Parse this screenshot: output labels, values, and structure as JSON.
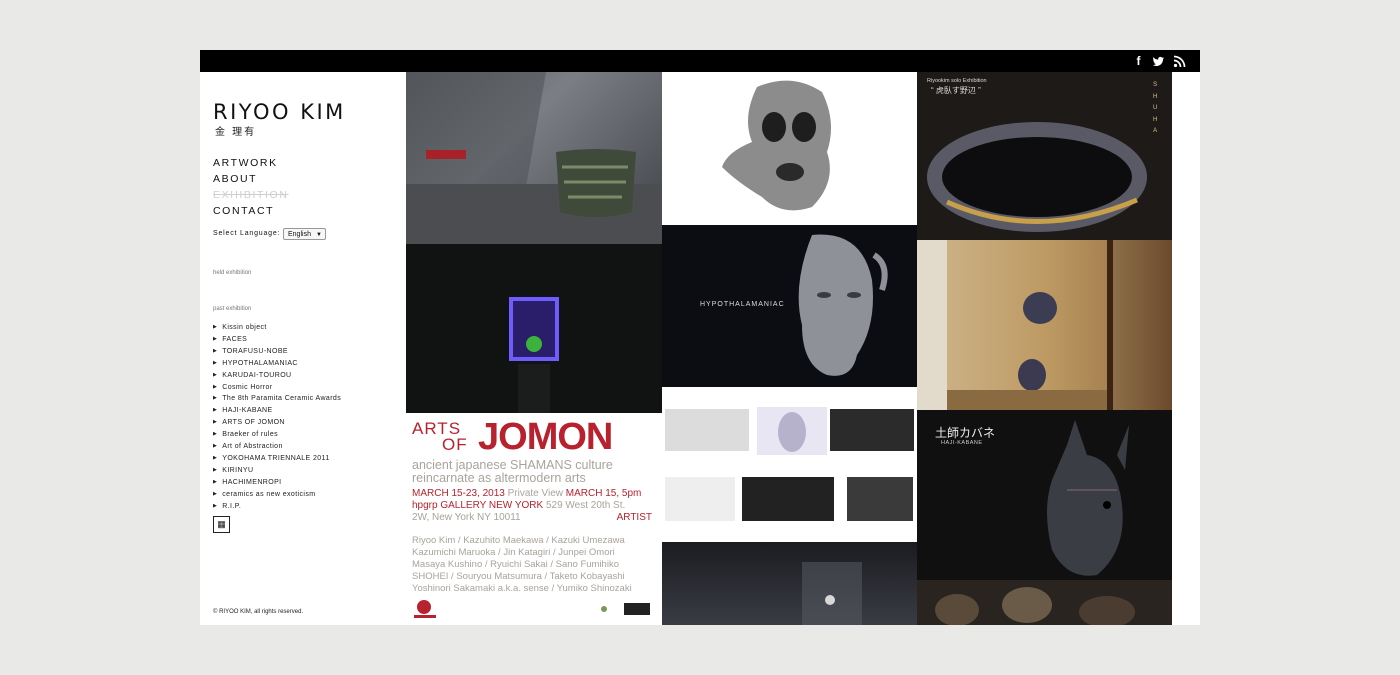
{
  "site": {
    "title": "RIYOO KIM",
    "subtitle": "金 理有",
    "nav": [
      "ARTWORK",
      "ABOUT",
      "EXHIBITION",
      "CONTACT"
    ],
    "language_label": "Select Language:",
    "language_value": "English",
    "held_label": "held exhibition",
    "past_label": "past exhibition",
    "past_items": [
      "Kissin object",
      "FACES",
      "TORAFUSU-NOBE",
      "HYPOTHALAMANIAC",
      "KARUDAI-TOUROU",
      "Cosmic Horror",
      "The 8th Paramita Ceramic Awards",
      "HAJI-KABANE",
      "ARTS OF JOMON",
      "Braeker of rules",
      "Art of Abstraction",
      "YOKOHAMA TRIENNALE 2011",
      "KIRINYU",
      "HACHIMENROPI",
      "ceramics as new exoticism",
      "R.I.P."
    ],
    "copyright": "© RIYOO KIM, all rights reserved."
  },
  "social": {
    "facebook": "f",
    "twitter": "t",
    "rss": "rss"
  },
  "icons": [
    "facebook-icon",
    "twitter-icon",
    "rss-icon",
    "chevron-down-icon",
    "triangle-right-icon",
    "stamp-icon"
  ],
  "tiles": {
    "hypothalamaniac_caption": "HYPOTHALAMANIAC",
    "shuha": {
      "header": "Riyookim solo Exhibition",
      "title": "“ 虎臥す野辺 ”",
      "vertical": [
        "S",
        "H",
        "U",
        "H",
        "A"
      ]
    },
    "haji": {
      "title": "土師カバネ",
      "sub": "HAJI-KABANE"
    },
    "poster": {
      "title_left_1": "ARTS",
      "title_left_2": "OF",
      "title_main": "JOMON",
      "line1": "ancient japanese SHAMANS culture",
      "line2": "reincarnate as altermodern arts",
      "dates": "MARCH 15-23, 2013",
      "private": "Private View",
      "private_date": "MARCH 15, 5pm",
      "gallery": "hpgrp GALLERY NEW YORK",
      "address1": "529 West 20th St.",
      "address2": "2W, New York NY 10011",
      "artist_label": "ARTIST",
      "artists": [
        "Riyoo Kim / Kazuhito Maekawa / Kazuki Umezawa",
        "Kazumichi Maruoka / Jin Katagiri / Junpei Omori",
        "Masaya Kushino / Ryuichi Sakai / Sano Fumihiko",
        "SHOHEI / Souryou Matsumura / Taketo Kobayashi",
        "Yoshinori Sakamaki a.k.a. sense / Yumiko Shinozaki"
      ]
    }
  },
  "colors": {
    "accent_red": "#b8222e",
    "poster_gray": "#a9a39b",
    "page_bg": "#e9e9e8"
  }
}
